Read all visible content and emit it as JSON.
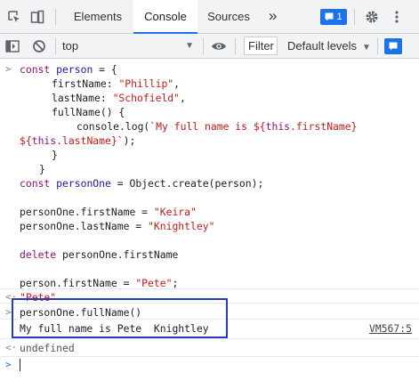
{
  "tabs": {
    "items": [
      {
        "label": "Elements"
      },
      {
        "label": "Console"
      },
      {
        "label": "Sources"
      }
    ],
    "more": "»",
    "badge_count": "1"
  },
  "toolbar": {
    "context": "top",
    "filter_placeholder": "Filter",
    "levels_label": "Default levels"
  },
  "code": {
    "l1": [
      "const ",
      "person",
      " = {"
    ],
    "l2": [
      "firstName: ",
      "\"Phillip\"",
      ","
    ],
    "l3": [
      "lastName: ",
      "\"Schofield\"",
      ","
    ],
    "l4": [
      "fullName() {"
    ],
    "l5": [
      "console.log(",
      "`My full name is ${",
      "this",
      ".firstName}"
    ],
    "l6": [
      "${",
      "this",
      ".lastName}`",
      ");"
    ],
    "l7": [
      "}"
    ],
    "l8": [
      "}"
    ],
    "l9": [
      "const ",
      "personOne",
      " = Object.create(person);"
    ],
    "l10": [
      "personOne.firstName = ",
      "\"Keira\""
    ],
    "l11": [
      "personOne.lastName = ",
      "\"Knightley\""
    ],
    "l12": [
      "delete ",
      "personOne.firstName"
    ],
    "l13": [
      "person.firstName = ",
      "\"Pete\"",
      ";"
    ]
  },
  "result_pete": "\"Pete\"",
  "call_line": "personOne.fullName()",
  "log_output": "My full name is Pete  Knightley",
  "source_link": "VM567:5",
  "undefined_text": "undefined",
  "icons": {
    "inspect": "inspect-element-icon",
    "device": "device-toolbar-icon",
    "settings": "gear-icon",
    "menu": "kebab-menu-icon",
    "sidebar": "console-sidebar-icon",
    "clear": "clear-console-icon",
    "eye": "live-expression-icon"
  },
  "colors": {
    "accent": "#1a73e8",
    "highlight_border": "#2b3bb7",
    "keyword": "#881280",
    "string": "#c41a16",
    "variable": "#1a1aa6"
  }
}
